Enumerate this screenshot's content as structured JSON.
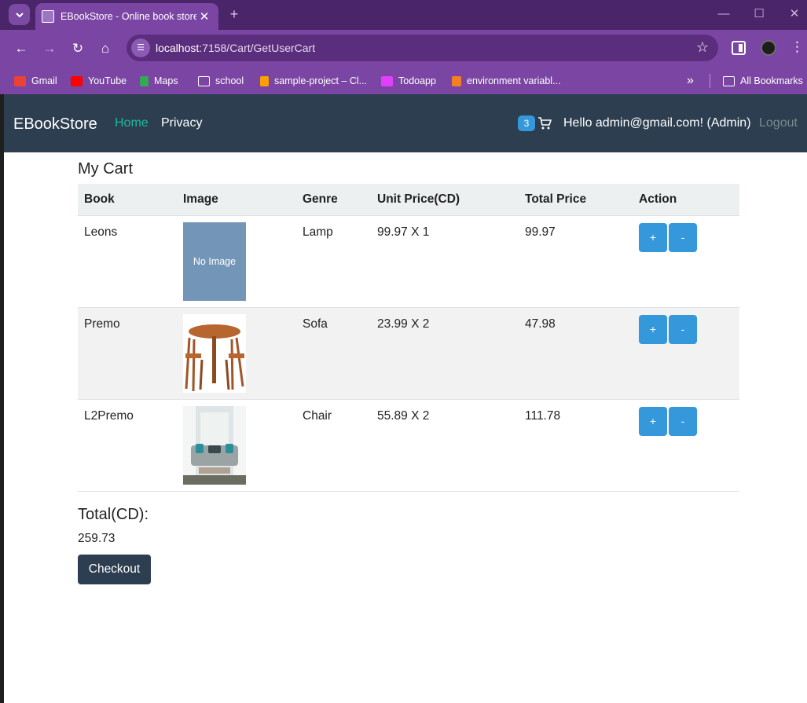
{
  "browser": {
    "tab_title": "EBookStore - Online book store",
    "tab_close": "✕",
    "new_tab": "+",
    "url_host": "localhost",
    "url_path": ":7158/Cart/GetUserCart",
    "bookmarks": [
      {
        "label": "Gmail",
        "color": "#ea4335"
      },
      {
        "label": "YouTube",
        "color": "#ff0000"
      },
      {
        "label": "Maps",
        "color": "#34a853"
      },
      {
        "label": "school",
        "color": "#ffffff"
      },
      {
        "label": "sample-project – Cl...",
        "color": "#ffa000"
      },
      {
        "label": "Todoapp",
        "color": "#e040fb"
      },
      {
        "label": "environment variabl...",
        "color": "#f48024"
      }
    ],
    "more_bookmarks": "»",
    "all_bookmarks": "All Bookmarks"
  },
  "app": {
    "brand": "EBookStore",
    "nav": {
      "home": "Home",
      "privacy": "Privacy"
    },
    "cart_count": "3",
    "greeting": "Hello admin@gmail.com! (Admin)",
    "logout": "Logout"
  },
  "cart": {
    "title": "My Cart",
    "columns": [
      "Book",
      "Image",
      "Genre",
      "Unit Price(CD)",
      "Total Price",
      "Action"
    ],
    "rows": [
      {
        "book": "Leons",
        "image": "No Image",
        "genre": "Lamp",
        "unit_price": "99.97 X 1",
        "total": "99.97",
        "plus": "+",
        "minus": "-"
      },
      {
        "book": "Premo",
        "image": "table-chairs-photo",
        "genre": "Sofa",
        "unit_price": "23.99 X 2",
        "total": "47.98",
        "plus": "+",
        "minus": "-"
      },
      {
        "book": "L2Premo",
        "image": "living-room-photo",
        "genre": "Chair",
        "unit_price": "55.89 X 2",
        "total": "111.78",
        "plus": "+",
        "minus": "-"
      }
    ],
    "total_label": "Total(CD):",
    "total_value": "259.73",
    "checkout": "Checkout"
  }
}
